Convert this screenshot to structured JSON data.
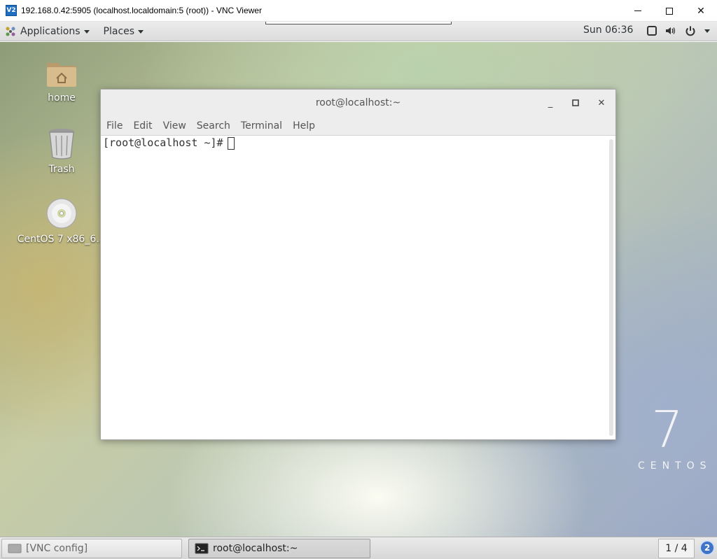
{
  "vnc_window": {
    "logo_text": "V2",
    "title": "192.168.0.42:5905 (localhost.localdomain:5 (root)) - VNC Viewer",
    "close_glyph": "✕"
  },
  "top_panel": {
    "applications_label": "Applications",
    "places_label": "Places",
    "clock": "Sun 06:36",
    "icons": [
      "applications-icon",
      "screen-icon",
      "volume-icon",
      "power-icon"
    ]
  },
  "desktop": {
    "icons": [
      {
        "label": "home",
        "icon": "home-folder-icon"
      },
      {
        "label": "Trash",
        "icon": "trash-icon"
      },
      {
        "label": "CentOS 7 x86_6…",
        "icon": "disc-icon"
      }
    ],
    "brand_number": "7",
    "brand_word": "CENTOS"
  },
  "terminal": {
    "title": "root@localhost:~",
    "min_glyph": "_",
    "close_glyph": "✕",
    "menu": [
      "File",
      "Edit",
      "View",
      "Search",
      "Terminal",
      "Help"
    ],
    "prompt": "[root@localhost ~]# "
  },
  "taskbar": {
    "items": [
      {
        "label": "[VNC config]",
        "icon": "window-icon"
      },
      {
        "label": "root@localhost:~",
        "icon": "terminal-icon"
      }
    ],
    "workspace": "1 / 4",
    "notification_count": "2"
  },
  "colors": {
    "panel_bg": "#dcdcdc",
    "terminal_bg": "#ffffff",
    "notification_badge": "#3f74c8"
  }
}
